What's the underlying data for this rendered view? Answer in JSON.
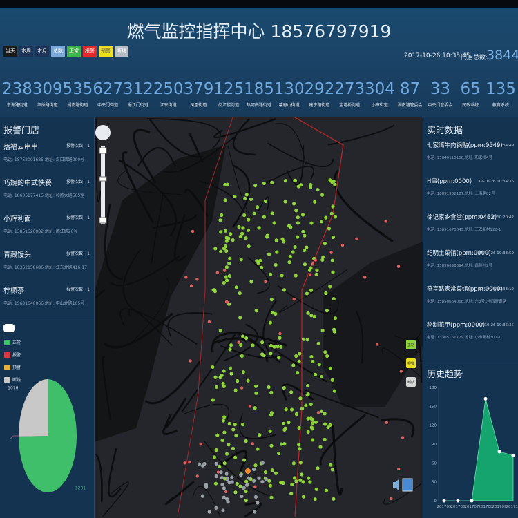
{
  "header": {
    "title": "燃气监控指挥中心 18576797919",
    "datetime": "2017-10-26 10:35:45",
    "total_label": "门店总数:",
    "total_value": "3844"
  },
  "filters": [
    {
      "label": "当天",
      "color": "#1a1a1a"
    },
    {
      "label": "本周",
      "color": "#1d3358"
    },
    {
      "label": "本月",
      "color": "#1d3358"
    },
    {
      "label": "总数",
      "color": "#7aa8d8"
    },
    {
      "label": "正常",
      "color": "#3cb44a"
    },
    {
      "label": "报警",
      "color": "#e02a2a"
    },
    {
      "label": "预警",
      "color": "#f0e020"
    },
    {
      "label": "断线",
      "color": "#b8bcc4"
    }
  ],
  "stats": [
    {
      "value": "238",
      "label": "宁海路街道"
    },
    {
      "value": "309",
      "label": "华侨路街道"
    },
    {
      "value": "535",
      "label": "湖南路街道"
    },
    {
      "value": "627",
      "label": "中央门街道"
    },
    {
      "value": "312",
      "label": "挹江门街道"
    },
    {
      "value": "250",
      "label": "江东街道"
    },
    {
      "value": "379",
      "label": "凤凰街道"
    },
    {
      "value": "125",
      "label": "阅江楼街道"
    },
    {
      "value": "185",
      "label": "热河南路街道"
    },
    {
      "value": "130",
      "label": "幕府山街道"
    },
    {
      "value": "292",
      "label": "建宁路街道"
    },
    {
      "value": "273",
      "label": "宝塔桥街道"
    },
    {
      "value": "304",
      "label": "小市街道"
    },
    {
      "value": "87",
      "label": "湖南路管委会"
    },
    {
      "value": "33",
      "label": "中央门管委会"
    },
    {
      "value": "65",
      "label": "民政系统"
    },
    {
      "value": "135",
      "label": "教育系统"
    }
  ],
  "alarm_stores": {
    "title": "报警门店",
    "items": [
      {
        "name": "落福云串串",
        "count": "报警次数：1",
        "detail": "电话: 18752001685,地址: 汉口西路200号"
      },
      {
        "name": "巧婉的中式快餐",
        "count": "报警次数：1",
        "detail": "电话: 18605177415,地址: 和燕大路505室"
      },
      {
        "name": "小辉利面",
        "count": "报警次数：1",
        "detail": "电话: 13851626082,地址: 燕江路20号"
      },
      {
        "name": "青藏馒头",
        "count": "报警次数：1",
        "detail": "电话: 18362158686,地址: 江东北路416-17"
      },
      {
        "name": "柠檬茶",
        "count": "报警次数：1",
        "detail": "电话: 15601640066,地址: 中山北路105号"
      }
    ]
  },
  "pie": {
    "legend": [
      {
        "label": "正常",
        "color": "#3fbf6a"
      },
      {
        "label": "报警",
        "color": "#d23a4a"
      },
      {
        "label": "预警",
        "color": "#e8b040"
      },
      {
        "label": "断线",
        "color": "#c8c8c8"
      }
    ],
    "slices": [
      {
        "label": "正常",
        "value": 3201,
        "color": "#3fbf6a"
      },
      {
        "label": "断线",
        "value": 1076,
        "color": "#c8c8c8"
      },
      {
        "label": "报警",
        "value": 0,
        "color": "#d23a4a"
      },
      {
        "label": "预警",
        "value": 0,
        "color": "#e8b040"
      }
    ]
  },
  "realtime": {
    "title": "实时数据",
    "items": [
      {
        "name": "七家湾牛肉锅贴(ppm:0549)",
        "time": "17-10-26 10:34:49",
        "detail": "电话: 15840110106,地址: 和家桥4号"
      },
      {
        "name": "H串(ppm:0000)",
        "time": "17-10-26 10:34:36",
        "detail": "电话: 18851982167,地址: 上海路82号"
      },
      {
        "name": "徐记家乡食堂(ppm:0452)",
        "time": "17-10-26 10:20:42",
        "detail": "电话: 13851670645,地址: 工农新村120-1"
      },
      {
        "name": "纪明土菜馆(ppm:0000)",
        "time": "17-10-26 10:33:59",
        "detail": "电话: 15850696694,地址: 岳侨村2号"
      },
      {
        "name": "燕亭路家常菜馆(ppm:0000)",
        "time": "17-10-26 10:33:19",
        "detail": "电话: 15850664066,地址: 东3号1幢西寄寄路"
      },
      {
        "name": "秘制花甲(ppm:0000)",
        "time": "17-10-26 10:35:35",
        "detail": "电话: 13305161729,地址: 小市新村301-1"
      }
    ]
  },
  "trend": {
    "title": "历史趋势"
  },
  "map_legend": [
    {
      "label": "正常",
      "color": "#8fd43a"
    },
    {
      "label": "报警",
      "color": "#e8e020"
    },
    {
      "label": "断线",
      "color": "#d8d8d8"
    }
  ],
  "chart_data": {
    "type": "area",
    "title": "历史趋势",
    "categories": [
      "201705",
      "201706",
      "201707",
      "201708",
      "201709",
      "201710"
    ],
    "values": [
      0,
      0,
      0,
      162,
      78,
      72
    ],
    "ylim": [
      0,
      180
    ],
    "yticks": [
      0,
      30,
      60,
      90,
      120,
      150,
      180
    ],
    "color": "#15a46e",
    "grid": false
  }
}
